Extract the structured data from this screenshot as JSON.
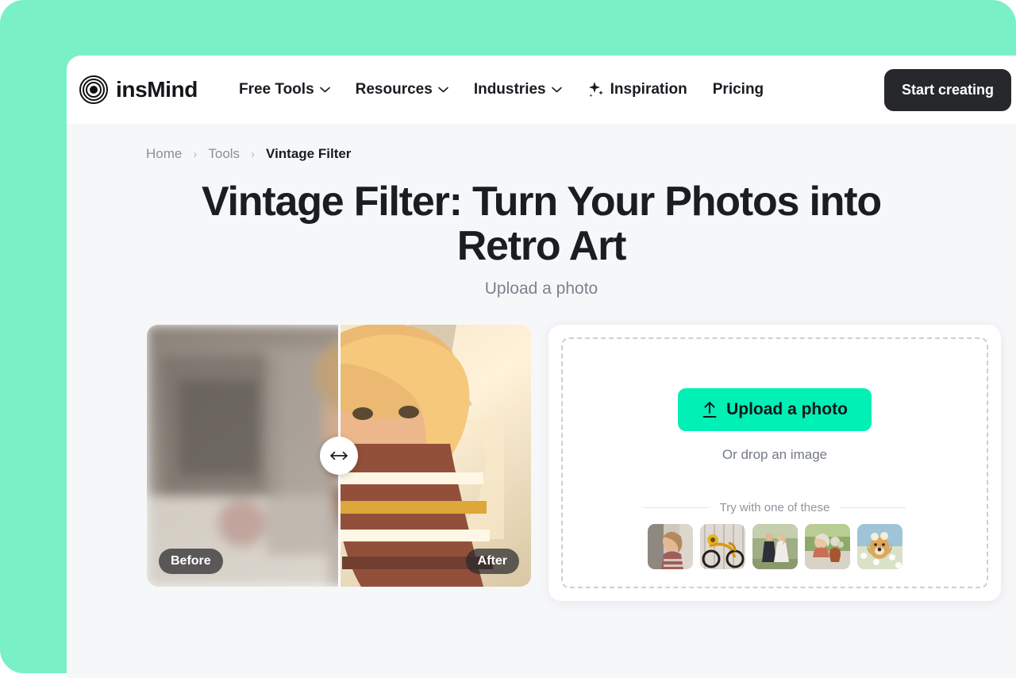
{
  "brand": {
    "name": "insMind",
    "logo_icon": "concentric-rings-logo"
  },
  "nav": {
    "items": [
      {
        "label": "Free Tools",
        "has_caret": true,
        "icon": "chevron-down-icon"
      },
      {
        "label": "Resources",
        "has_caret": true,
        "icon": "chevron-down-icon"
      },
      {
        "label": "Industries",
        "has_caret": true,
        "icon": "chevron-down-icon"
      },
      {
        "label": "Inspiration",
        "has_caret": false,
        "icon": "sparkle-icon"
      },
      {
        "label": "Pricing",
        "has_caret": false,
        "icon": ""
      }
    ],
    "cta_label": "Start creating"
  },
  "breadcrumb": {
    "items": [
      "Home",
      "Tools",
      "Vintage Filter"
    ],
    "separator": "›"
  },
  "hero": {
    "title": "Vintage Filter: Turn Your Photos into Retro Art",
    "subtitle": "Upload a photo"
  },
  "comparison": {
    "before_label": "Before",
    "after_label": "After",
    "handle_icon": "left-right-arrow-icon",
    "alt": "Smiling blonde woman in striped shirt, blurred original versus retro painted result"
  },
  "upload": {
    "button_label": "Upload a photo",
    "button_icon": "upload-arrow-icon",
    "drop_hint": "Or drop an image",
    "samples_label": "Try with one of these",
    "samples": [
      {
        "name": "sample-woman-portrait"
      },
      {
        "name": "sample-bicycle-sunflowers"
      },
      {
        "name": "sample-wedding-couple"
      },
      {
        "name": "sample-woman-with-vase"
      },
      {
        "name": "sample-dog-in-daisies"
      }
    ]
  },
  "colors": {
    "backdrop_mint": "#79F0C6",
    "page_bg": "#F6F7F9",
    "accent_green": "#00F0B5",
    "cta_dark": "#26282C",
    "text_dark": "#1A1C21",
    "text_muted": "#8A9099"
  }
}
